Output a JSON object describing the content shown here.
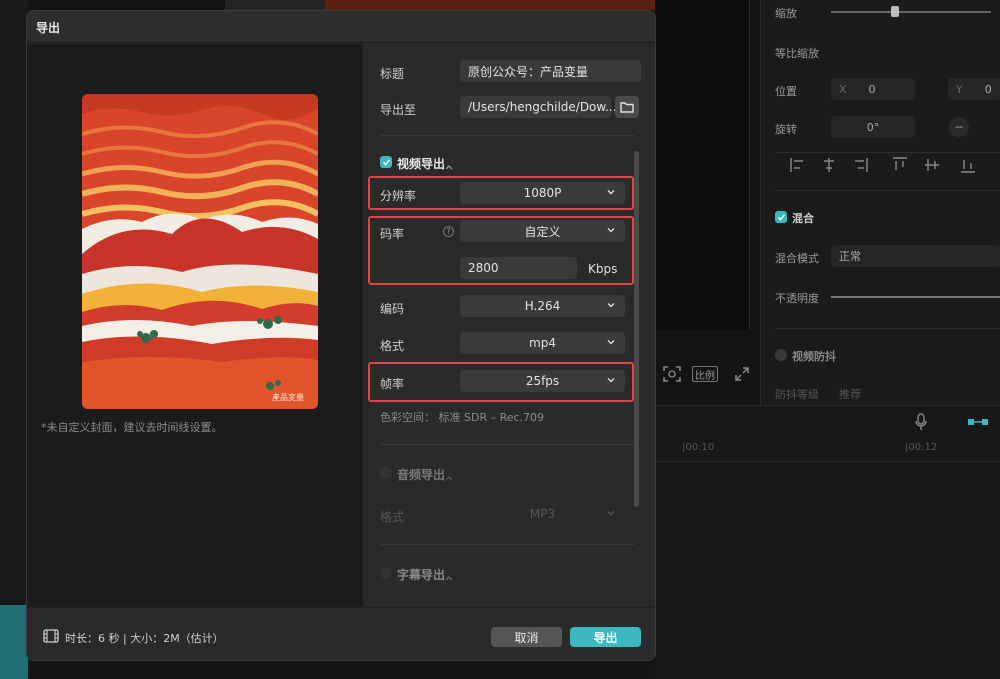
{
  "dialog": {
    "title": "导出",
    "cover_note": "*未自定义封面，建议去时间线设置。",
    "cover_watermark": "產品変量",
    "title_label": "标题",
    "title_value": "原创公众号：产品变量",
    "export_to_label": "导出至",
    "export_path": "/Users/hengchilde/Dow...",
    "video_section": "视频导出",
    "resolution_label": "分辨率",
    "resolution_value": "1080P",
    "bitrate_label": "码率",
    "bitrate_value": "自定义",
    "bitrate_input": "2800",
    "bitrate_unit": "Kbps",
    "codec_label": "编码",
    "codec_value": "H.264",
    "format_label": "格式",
    "format_value": "mp4",
    "framerate_label": "帧率",
    "framerate_value": "25fps",
    "color_space": "色彩空间：  标准 SDR – Rec.709",
    "audio_section": "音频导出",
    "audio_format_label": "格式",
    "audio_format_value": "MP3",
    "subtitle_section": "字幕导出",
    "footer_info": "时长：6 秒 | 大小：2M（估计）",
    "cancel_label": "取消",
    "export_label": "导出"
  },
  "right_panel": {
    "scale_label": "缩放",
    "uniform_scale_label": "等比缩放",
    "position_label": "位置",
    "pos_x_label": "X",
    "pos_x_value": "0",
    "pos_y_label": "Y",
    "pos_y_value": "0",
    "rotate_label": "旋转",
    "rotate_value": "0°",
    "blend_label": "混合",
    "blend_mode_label": "混合模式",
    "blend_mode_value": "正常",
    "opacity_label": "不透明度",
    "stabilize_label": "视频防抖",
    "stabilize_sub_label": "防抖等级",
    "stabilize_sub_value": "推荐"
  },
  "preview_controls": {
    "ratio_label": "比例"
  },
  "timeline": {
    "ticks": [
      "|00:10",
      "|00:12"
    ]
  },
  "colors": {
    "accent": "#3bb8c1",
    "highlight": "#d9474b"
  }
}
